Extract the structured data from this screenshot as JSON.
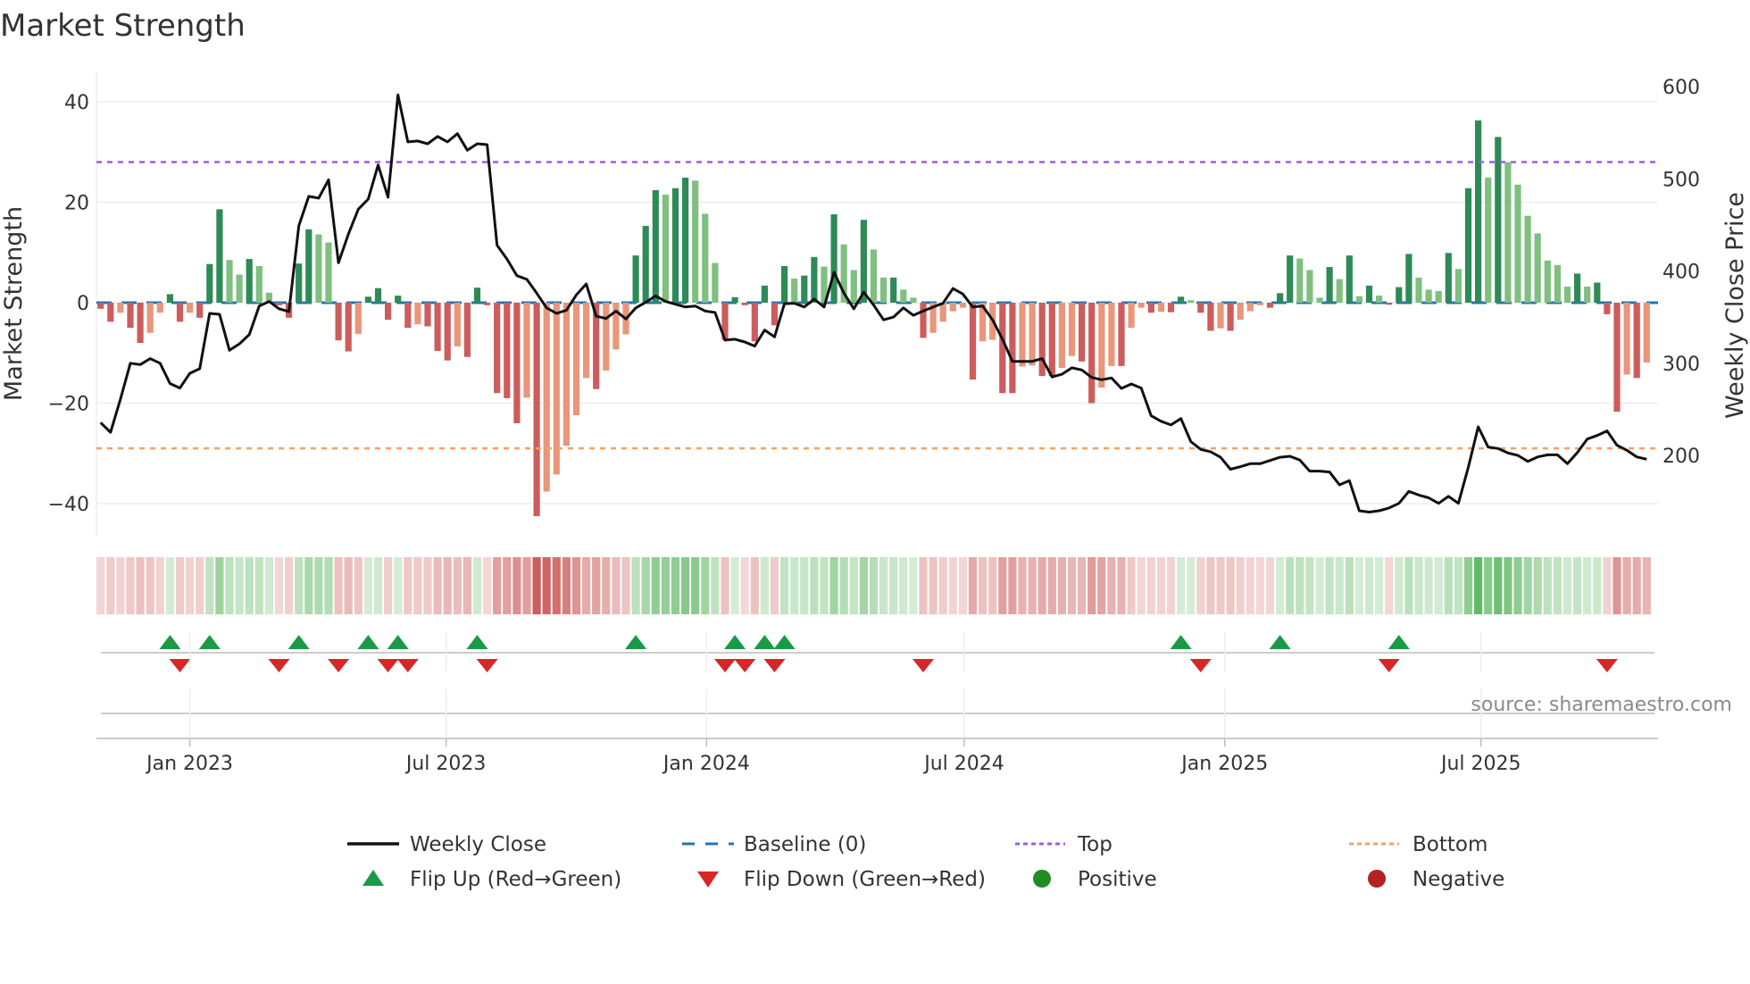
{
  "title": "Market Strength",
  "source": "source: sharemaestro.com",
  "colors": {
    "pos_strong": "#2e8b57",
    "pos_weak": "#7fbf7f",
    "neg_strong": "#cd5c5c",
    "neg_weak": "#e9967a",
    "close_line": "#111111",
    "baseline": "#1f77b4",
    "top": "#9b5de5",
    "bottom": "#f4a261",
    "flip_up": "#1a9a46",
    "flip_down": "#d62728",
    "positive": "#228b22",
    "negative": "#b22222"
  },
  "legend": {
    "weekly_close": "Weekly Close",
    "baseline": "Baseline (0)",
    "top": "Top",
    "bottom": "Bottom",
    "flip_up": "Flip Up (Red→Green)",
    "flip_down": "Flip Down (Green→Red)",
    "positive": "Positive",
    "negative": "Negative"
  },
  "chart_data": {
    "type": "bar",
    "title": "Market Strength",
    "xlabel": "",
    "ylabel": "Market Strength",
    "y2label": "Weekly Close Price",
    "frequency": "weekly",
    "start_week": "2022-10-30",
    "ylim": [
      -46,
      46
    ],
    "y2lim": [
      113,
      616
    ],
    "yticks": [
      40,
      20,
      0,
      -20,
      -40
    ],
    "yticklabels": [
      "40",
      "20",
      "0",
      "−20",
      "−40"
    ],
    "y2ticks": [
      600,
      500,
      400,
      300,
      200
    ],
    "y2ticklabels": [
      "600",
      "500",
      "400",
      "300",
      "200"
    ],
    "xticks": [
      {
        "date": "2023-01-01",
        "label": "Jan 2023"
      },
      {
        "date": "2023-07-01",
        "label": "Jul 2023"
      },
      {
        "date": "2024-01-01",
        "label": "Jan 2024"
      },
      {
        "date": "2024-07-01",
        "label": "Jul 2024"
      },
      {
        "date": "2025-01-01",
        "label": "Jan 2025"
      },
      {
        "date": "2025-07-01",
        "label": "Jul 2025"
      }
    ],
    "top_level": 28,
    "bottom_level": -29,
    "baseline": 0,
    "grid": true,
    "legend_position": "bottom",
    "strength": [
      -1.2,
      -3.8,
      -2,
      -5,
      -8,
      -6,
      -2,
      1.7,
      -3.8,
      -2,
      -3,
      7.7,
      18.6,
      8.5,
      5.6,
      8.7,
      7.3,
      2,
      -0.5,
      -3,
      7.8,
      14.6,
      13.6,
      12,
      -7.5,
      -9.7,
      -6.2,
      1.2,
      2.9,
      -3.4,
      1.4,
      -5,
      -4.3,
      -4.7,
      -9.6,
      -11.5,
      -8.7,
      -10.8,
      3,
      -0.5,
      -18,
      -19,
      -24,
      -18.9,
      -42.5,
      -37.6,
      -34.2,
      -28.5,
      -22.4,
      -15,
      -17.2,
      -13.5,
      -9.3,
      -6.3,
      9.4,
      15.3,
      22.4,
      21.5,
      22.8,
      24.9,
      24.3,
      17.7,
      7.9,
      -7.4,
      1.1,
      -0.5,
      -7.7,
      3.4,
      -4.5,
      7.3,
      4.8,
      5.4,
      9.1,
      7.2,
      17.6,
      11.6,
      6.5,
      16.5,
      10.6,
      5,
      5,
      2.6,
      1,
      -7,
      -6,
      -3.8,
      -1.7,
      -1,
      -15.3,
      -7.7,
      -7.4,
      -18,
      -18,
      -12.7,
      -12.5,
      -14.6,
      -14.6,
      -13,
      -10.6,
      -11.7,
      -20,
      -16.9,
      -12.6,
      -12.6,
      -5,
      -1,
      -2,
      -1.8,
      -1.9,
      1.2,
      0.5,
      -2,
      -5.6,
      -5.1,
      -5.6,
      -3.4,
      -1.7,
      -0.5,
      -1,
      1.9,
      9.4,
      8.8,
      6.5,
      1,
      7.1,
      4.7,
      9.4,
      1.3,
      3.4,
      1.4,
      -0.4,
      3.1,
      9.7,
      5,
      2.6,
      2.3,
      9.9,
      6.7,
      22.8,
      36.3,
      24.9,
      33,
      28,
      23.5,
      17.3,
      13.8,
      8.4,
      7.5,
      3.2,
      5.8,
      3.2,
      4,
      -2.3,
      -21.7,
      -14.3,
      -15,
      -11.9
    ],
    "weekly_close": [
      235.5,
      225,
      261,
      300,
      298.5,
      305,
      300,
      278,
      273,
      289,
      294,
      354,
      353,
      314,
      321,
      331,
      362,
      367,
      359,
      356,
      449,
      481,
      479,
      499,
      409,
      440,
      467,
      478,
      515,
      480,
      591,
      540,
      541,
      538,
      546,
      540,
      549,
      531,
      538,
      537,
      428,
      413,
      395,
      391,
      376,
      360,
      354,
      357.5,
      374,
      386,
      351,
      348.5,
      356.6,
      348,
      360,
      366,
      373,
      367,
      364,
      361,
      362,
      356.6,
      355,
      325,
      326,
      323,
      318.5,
      336,
      328.5,
      364.6,
      365,
      361,
      369.5,
      361,
      398.5,
      376,
      359,
      377,
      363,
      347,
      350,
      360,
      352,
      356.6,
      361,
      365,
      381,
      375,
      361,
      362,
      347,
      326,
      302,
      302,
      302,
      305,
      285,
      288,
      295,
      292.7,
      284.6,
      282,
      284,
      272.6,
      277.5,
      273,
      243,
      237,
      233,
      240,
      215,
      206.5,
      204,
      198,
      185,
      187.7,
      191,
      191,
      194.5,
      198,
      199,
      195,
      183,
      183,
      182,
      168,
      172.6,
      140,
      138.5,
      140,
      143,
      148,
      161,
      157,
      154,
      148,
      155.5,
      148,
      187,
      231,
      209,
      207.5,
      202.6,
      200,
      193.5,
      198.4,
      200.6,
      200.6,
      191,
      203,
      217.7,
      221.6,
      226.5,
      211,
      205.5,
      198.4,
      195.8
    ],
    "flip_up_weeks": [
      7,
      11,
      20,
      27,
      30,
      38,
      54,
      64,
      67,
      69,
      109,
      119,
      131
    ],
    "flip_down_weeks": [
      8,
      18,
      24,
      29,
      31,
      39,
      63,
      65,
      68,
      83,
      111,
      130,
      152
    ]
  }
}
